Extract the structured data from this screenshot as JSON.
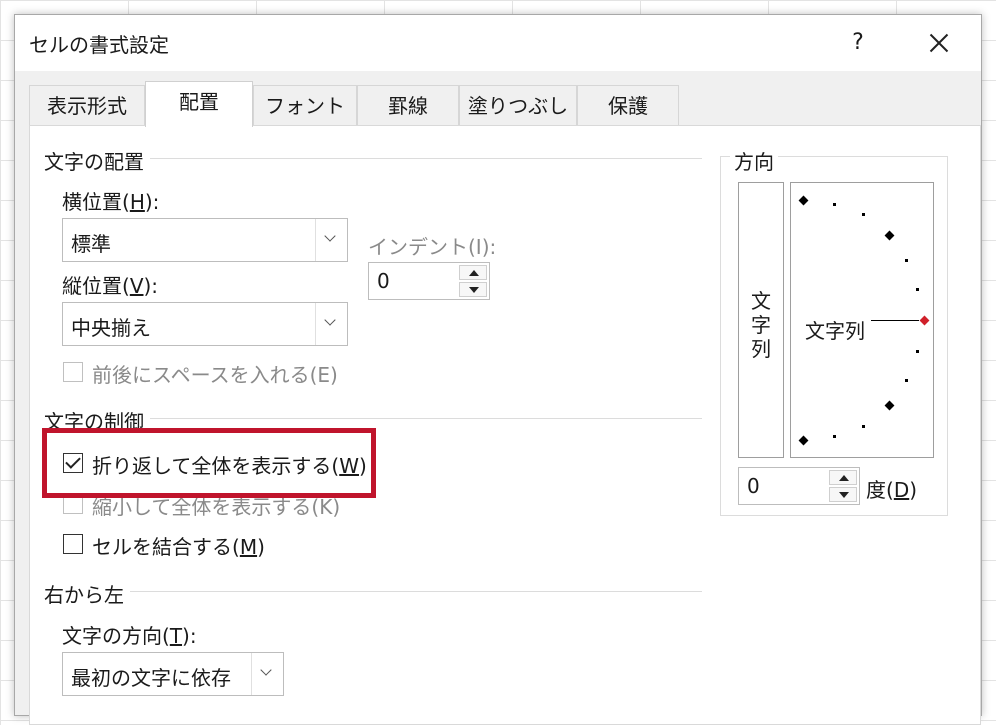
{
  "dialog": {
    "title": "セルの書式設定",
    "help": "?"
  },
  "tabs": [
    {
      "label": "表示形式"
    },
    {
      "label": "配置"
    },
    {
      "label": "フォント"
    },
    {
      "label": "罫線"
    },
    {
      "label": "塗りつぶし"
    },
    {
      "label": "保護"
    }
  ],
  "alignment": {
    "section_title": "文字の配置",
    "horizontal_label": "横位置(",
    "horizontal_key": "H",
    "horizontal_label_end": "):",
    "horizontal_value": "標準",
    "indent_label": "インデント(I):",
    "indent_value": "0",
    "vertical_label": "縦位置(",
    "vertical_key": "V",
    "vertical_label_end": "):",
    "vertical_value": "中央揃え",
    "space_label": "前後にスペースを入れる(E)"
  },
  "control": {
    "section_title": "文字の制御",
    "wrap_label": "折り返して全体を表示する(",
    "wrap_key": "W",
    "wrap_label_end": ")",
    "wrap_checked": true,
    "shrink_label": "縮小して全体を表示する(K)",
    "merge_label": "セルを結合する(",
    "merge_key": "M",
    "merge_label_end": ")"
  },
  "rtl": {
    "section_title": "右から左",
    "direction_label": "文字の方向(",
    "direction_key": "T",
    "direction_label_end": "):",
    "direction_value": "最初の文字に依存"
  },
  "orientation": {
    "section_title": "方向",
    "vertical_chars": [
      "文",
      "字",
      "列"
    ],
    "dial_text": "文字列",
    "degree_value": "0",
    "degree_label": "度(",
    "degree_key": "D",
    "degree_label_end": ")"
  },
  "colors": {
    "highlight": "#c0142c",
    "dial_active": "#d0202a"
  }
}
